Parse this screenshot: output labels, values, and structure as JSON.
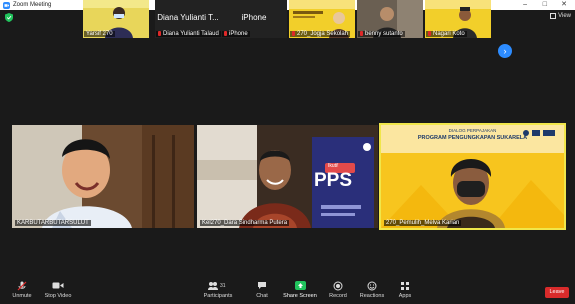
{
  "window": {
    "title": "Zoom Meeting"
  },
  "topbar": {
    "view_label": "View"
  },
  "thumbnails": [
    {
      "name": "Yarsif 270",
      "muted": false
    },
    {
      "name": "Diana Yulianti Talaud",
      "header": "Diana Yulianti T...",
      "muted": true
    },
    {
      "name": "iPhone",
      "header": "iPhone",
      "muted": true
    },
    {
      "name": "270_Jogja Sekolah",
      "muted": true
    },
    {
      "name": "benny sutanto",
      "muted": true
    },
    {
      "name": "Nagari Koto",
      "muted": true
    }
  ],
  "tiles": [
    {
      "name": "KARBUTARBUTARSULUT"
    },
    {
      "name": "Kel270_Dara Sindharma Putera"
    },
    {
      "name": "270_Pemulih_Melva Karian",
      "banner_top": "DIALOG PERPAJAKAN",
      "banner_title": "PROGRAM PENGUNGKAPAN SUKARELA"
    }
  ],
  "slide": {
    "logo": "PPS",
    "badge": "Ikuti!"
  },
  "toolbar": {
    "unmute": "Unmute",
    "stop_video": "Stop Video",
    "participants": "Participants",
    "participant_count": "31",
    "chat": "Chat",
    "share_screen": "Share Screen",
    "record": "Record",
    "reactions": "Reactions",
    "apps": "Apps",
    "leave": "Leave"
  },
  "colors": {
    "accent": "#2d8cff",
    "leave": "#d92b2b",
    "share": "#21c45d",
    "active_outline": "#f0e64a",
    "banner": "#f7c51e"
  }
}
